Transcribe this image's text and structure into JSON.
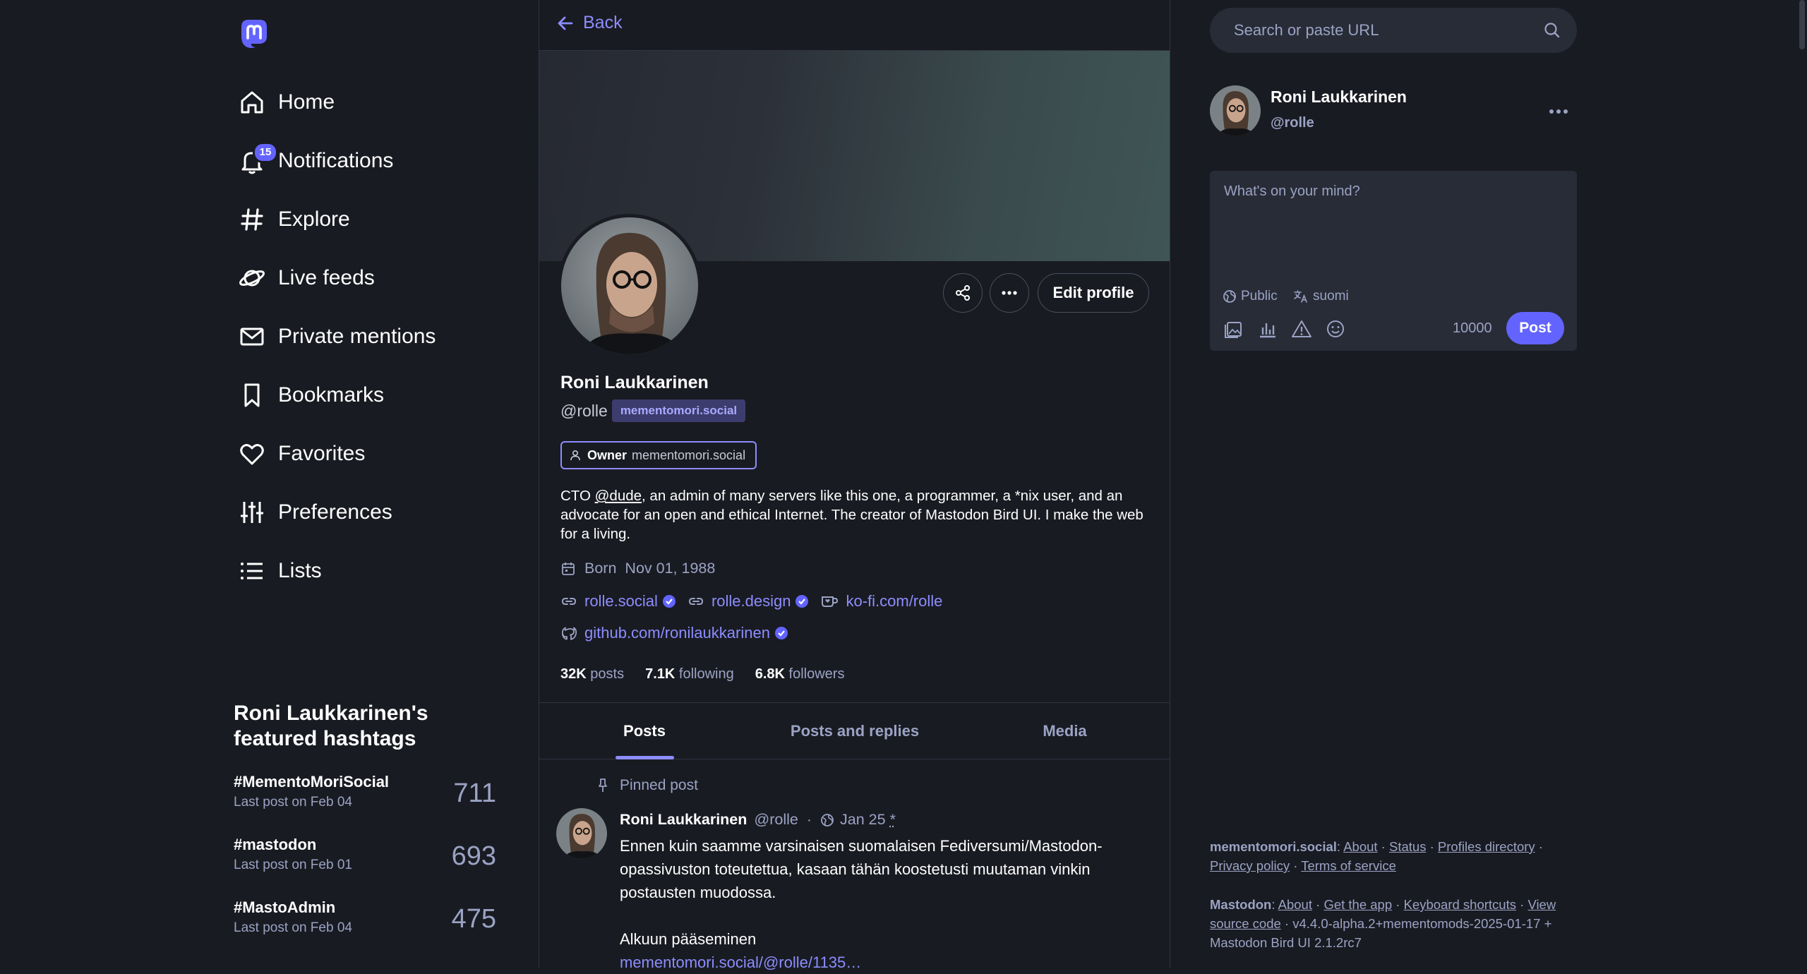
{
  "colors": {
    "background": "#191b22",
    "panel": "#282c37",
    "accent": "#6364ff",
    "accent_text": "#8c8dff",
    "muted": "#9ba3c4",
    "border": "#313543"
  },
  "nav": {
    "logo_icon": "mastodon-logo-icon",
    "items": [
      {
        "label": "Home",
        "icon": "home-icon"
      },
      {
        "label": "Notifications",
        "icon": "bell-icon",
        "badge": "15"
      },
      {
        "label": "Explore",
        "icon": "hashtag-icon"
      },
      {
        "label": "Live feeds",
        "icon": "planet-icon"
      },
      {
        "label": "Private mentions",
        "icon": "envelope-icon"
      },
      {
        "label": "Bookmarks",
        "icon": "bookmark-icon"
      },
      {
        "label": "Favorites",
        "icon": "heart-icon"
      },
      {
        "label": "Preferences",
        "icon": "sliders-icon"
      },
      {
        "label": "Lists",
        "icon": "list-icon"
      }
    ]
  },
  "featured": {
    "title": "Roni Laukkarinen's featured hashtags",
    "tags": [
      {
        "name": "#MementoMoriSocial",
        "last_post": "Last post on Feb 04",
        "count": "711"
      },
      {
        "name": "#mastodon",
        "last_post": "Last post on Feb 01",
        "count": "693"
      },
      {
        "name": "#MastoAdmin",
        "last_post": "Last post on Feb 04",
        "count": "475"
      }
    ]
  },
  "profile": {
    "back_label": "Back",
    "edit_label": "Edit profile",
    "display_name": "Roni Laukkarinen",
    "acct": "@rolle",
    "domain": "mementomori.social",
    "role": {
      "name": "Owner",
      "server": "mementomori.social"
    },
    "bio": {
      "prefix": "CTO ",
      "mention": "@dude",
      "suffix": ", an admin of many servers like this one, a programmer, a *nix user, and an advocate for an open and ethical Internet. The creator of Mastodon Bird UI. I make the web for a living."
    },
    "born": {
      "label": "Born",
      "value": "Nov 01, 1988"
    },
    "links_row1": [
      {
        "text": "rolle.social",
        "verified": true,
        "icon": "link-icon"
      },
      {
        "text": "rolle.design",
        "verified": true,
        "icon": "link-icon"
      },
      {
        "text": "ko-fi.com/rolle",
        "verified": false,
        "icon": "coffee-cup-icon"
      }
    ],
    "links_row2": [
      {
        "text": "github.com/ronilaukkarinen",
        "verified": true,
        "icon": "github-icon"
      }
    ],
    "stats": {
      "posts_value": "32K",
      "posts_label": "posts",
      "following_value": "7.1K",
      "following_label": "following",
      "followers_value": "6.8K",
      "followers_label": "followers"
    },
    "tabs": [
      "Posts",
      "Posts and replies",
      "Media"
    ],
    "active_tab": "Posts"
  },
  "pinned_post": {
    "label": "Pinned post",
    "author": "Roni Laukkarinen",
    "handle": "@rolle",
    "separator": "·",
    "date": "Jan 25",
    "edited_marker": "*",
    "paragraph1": "Ennen kuin saamme varsinaisen suomalaisen Fediversumi/Mastodon-opassivuston toteutettua, kasaan tähän koostetusti muutaman vinkin postausten muodossa.",
    "paragraph2": "Alkuun pääseminen",
    "link": "mementomori.social/@rolle/1135…"
  },
  "right": {
    "search_placeholder": "Search or paste URL",
    "me_name": "Roni Laukkarinen",
    "me_handle": "@rolle",
    "composer_placeholder": "What's on your mind?",
    "visibility": "Public",
    "language": "suomi",
    "char_count": "10000",
    "post_label": "Post"
  },
  "footer": {
    "server": "mementomori.social",
    "server_links": [
      "About",
      "Status",
      "Profiles directory",
      "Privacy policy",
      "Terms of service"
    ],
    "app": "Mastodon",
    "app_links": [
      "About",
      "Get the app",
      "Keyboard shortcuts",
      "View source code"
    ],
    "version": "v4.4.0-alpha.2+mementomods-2025-01-17 + Mastodon Bird UI 2.1.2rc7"
  }
}
